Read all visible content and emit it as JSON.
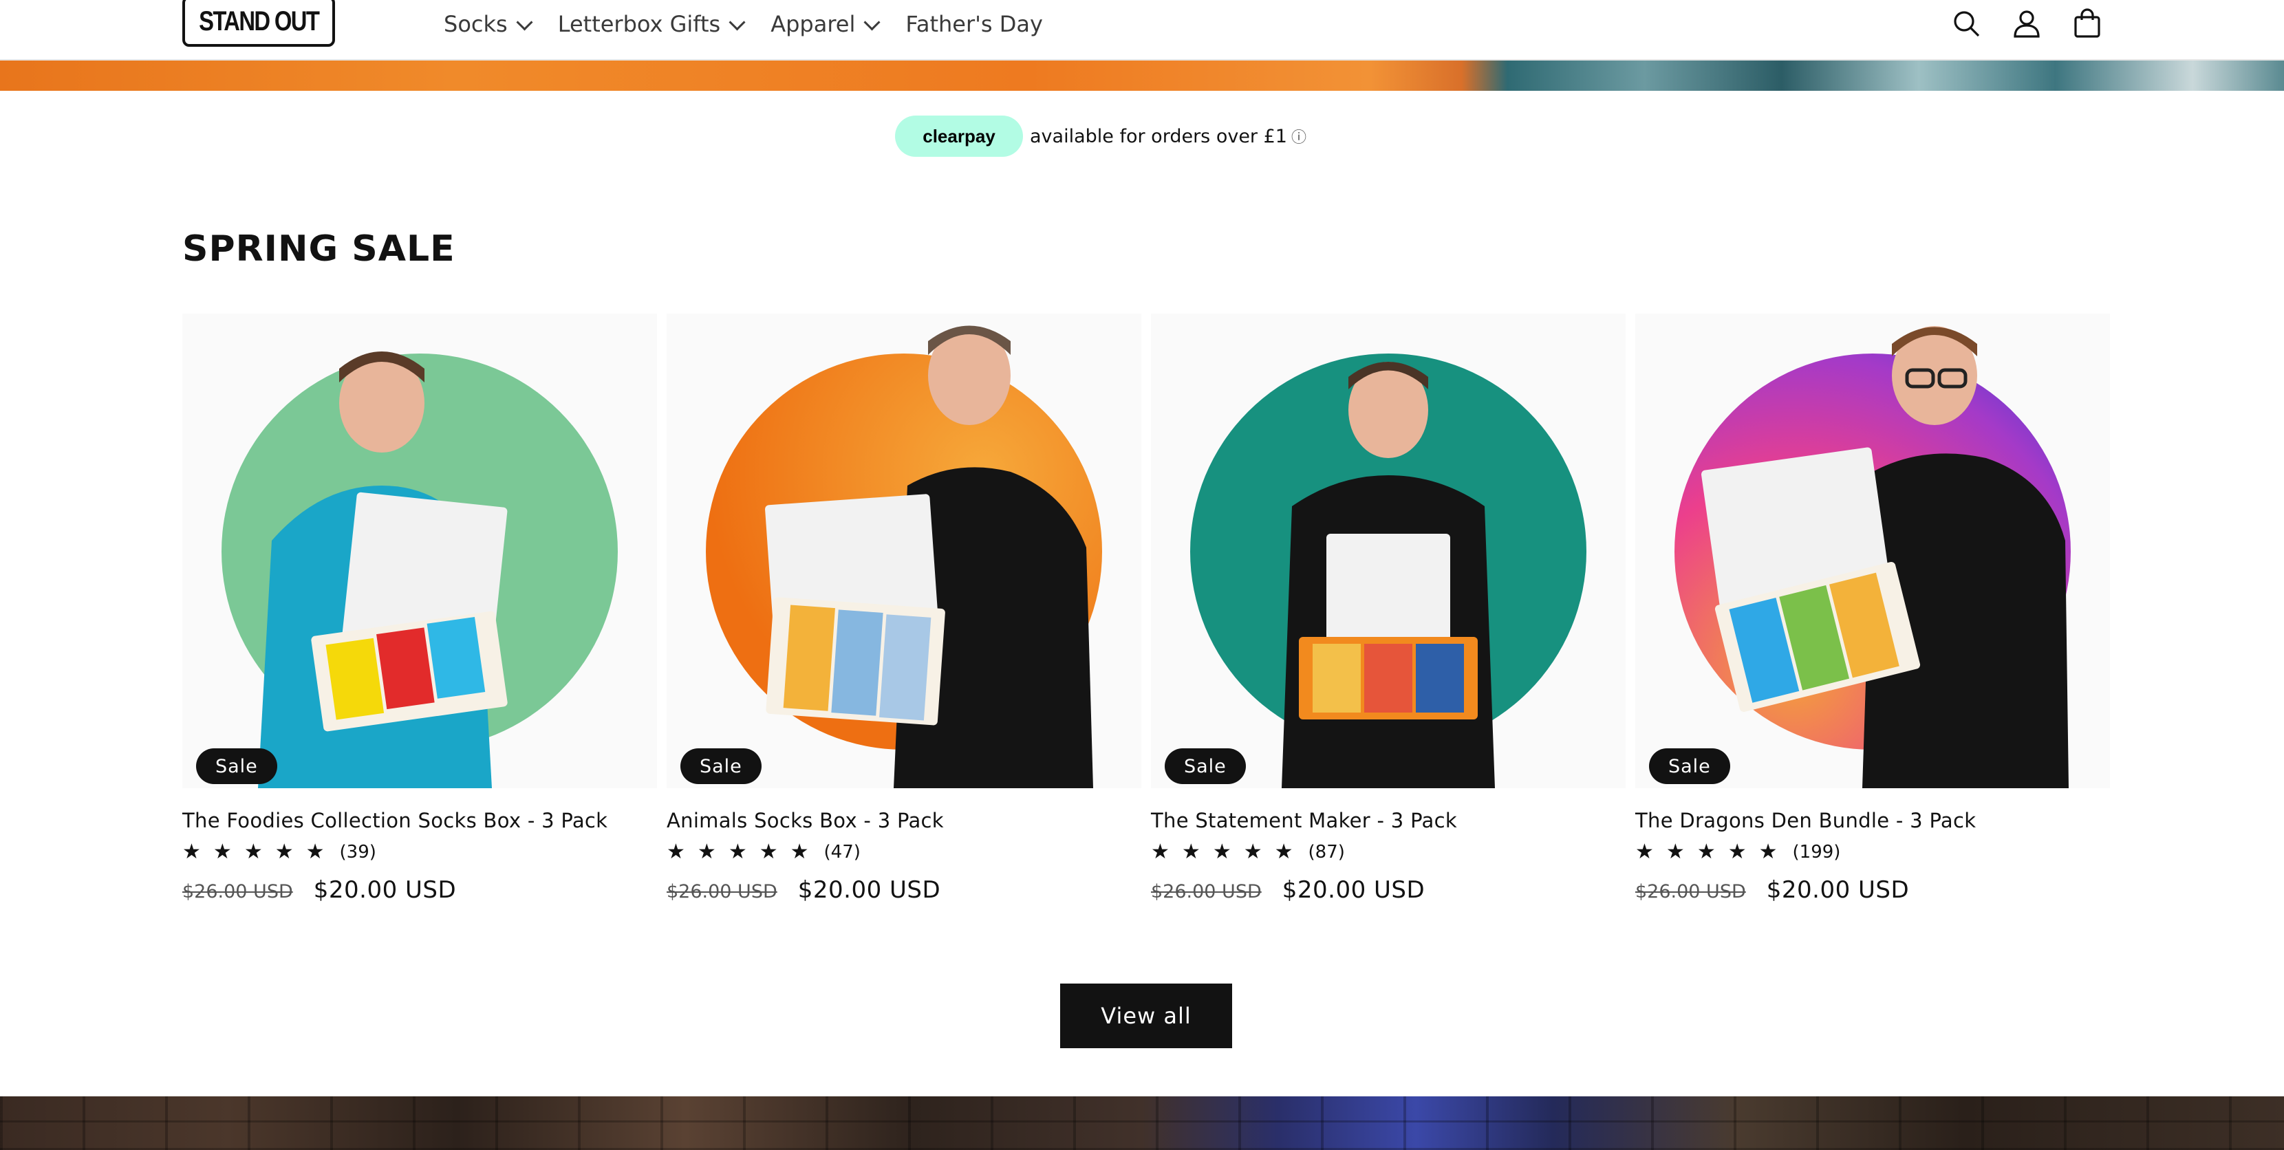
{
  "header": {
    "logo_text": "STAND OUT",
    "nav": [
      {
        "label": "Socks",
        "has_dropdown": true
      },
      {
        "label": "Letterbox Gifts",
        "has_dropdown": true
      },
      {
        "label": "Apparel",
        "has_dropdown": true
      },
      {
        "label": "Father's Day",
        "has_dropdown": false
      }
    ],
    "icons": [
      "search-icon",
      "account-icon",
      "cart-icon"
    ]
  },
  "clearpay": {
    "badge": "clearpay",
    "text": "available for orders over £1",
    "info_glyph": "ⓘ"
  },
  "section": {
    "title": "SPRING SALE"
  },
  "products": [
    {
      "title": "The Foodies Collection Socks Box - 3 Pack",
      "badge": "Sale",
      "stars": 5,
      "review_count": "(39)",
      "price_old": "$26.00 USD",
      "price_new": "$20.00 USD",
      "circle_color": "#7bc896"
    },
    {
      "title": "Animals Socks Box - 3 Pack",
      "badge": "Sale",
      "stars": 5,
      "review_count": "(47)",
      "price_old": "$26.00 USD",
      "price_new": "$20.00 USD",
      "circle_color": "#f28a1e"
    },
    {
      "title": "The Statement Maker - 3 Pack",
      "badge": "Sale",
      "stars": 5,
      "review_count": "(87)",
      "price_old": "$26.00 USD",
      "price_new": "$20.00 USD",
      "circle_color": "#17917f"
    },
    {
      "title": "The Dragons Den Bundle - 3 Pack",
      "badge": "Sale",
      "stars": 5,
      "review_count": "(199)",
      "price_old": "$26.00 USD",
      "price_new": "$20.00 USD",
      "circle_color": "#e33bb6"
    }
  ],
  "view_all": {
    "label": "View all"
  },
  "colors": {
    "text": "#121212",
    "clearpay_mint": "#b2fce4",
    "button_bg": "#121212"
  }
}
